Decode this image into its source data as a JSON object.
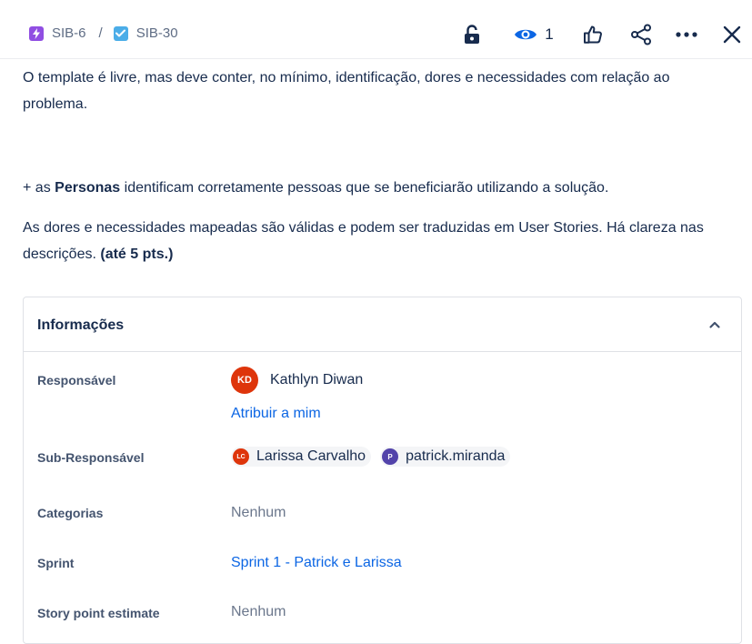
{
  "breadcrumb": {
    "parent": {
      "key": "SIB-6",
      "icon": "lightning-icon",
      "color": "#904ee2"
    },
    "current": {
      "key": "SIB-30",
      "icon": "checkbox-icon",
      "color": "#4bade8"
    },
    "separator": "/"
  },
  "toolbar": {
    "lock_icon": "unlock-icon",
    "watch_count": "1",
    "like_icon": "thumbs-up-icon",
    "share_icon": "share-icon",
    "more_icon": "more-icon",
    "close_icon": "close-icon"
  },
  "description": {
    "p1": "O template é livre, mas deve conter, no mínimo, identificação, dores e necessidades com relação ao problema.",
    "p2_prefix": "+ as ",
    "p2_bold": "Personas",
    "p2_suffix": " identificam corretamente pessoas que se beneficiarão utilizando a solução.",
    "p3_text": "As dores e necessidades mapeadas são válidas e podem ser traduzidas em User Stories. Há clareza nas descrições. ",
    "p3_bold": "(até 5 pts.)"
  },
  "panel": {
    "title": "Informações",
    "assignee_label": "Responsável",
    "assignee": {
      "initials": "KD",
      "name": "Kathlyn Diwan",
      "color": "#de350b"
    },
    "assign_to_me": "Atribuir a mim",
    "sub_assignee_label": "Sub-Responsável",
    "sub_assignees": [
      {
        "initials": "LC",
        "name": "Larissa Carvalho",
        "color": "#de350b"
      },
      {
        "initials": "P",
        "name": "patrick.miranda",
        "color": "#5243aa"
      }
    ],
    "categories_label": "Categorias",
    "categories_value": "Nenhum",
    "sprint_label": "Sprint",
    "sprint_value": "Sprint 1 - Patrick e Larissa",
    "story_points_label": "Story point estimate",
    "story_points_value": "Nenhum"
  }
}
